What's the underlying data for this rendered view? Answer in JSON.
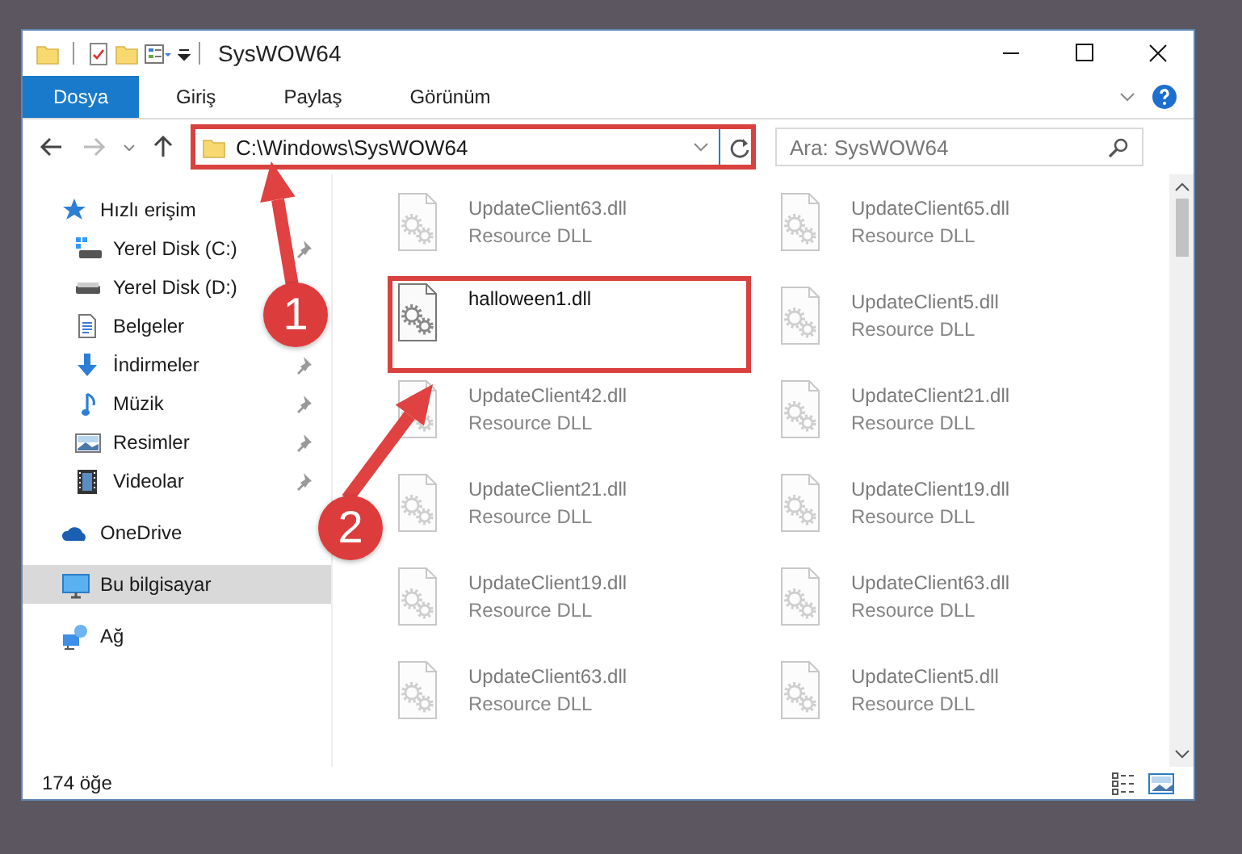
{
  "window": {
    "title": "SysWOW64"
  },
  "ribbon_tabs": [
    {
      "label": "Dosya",
      "selected": true
    },
    {
      "label": "Giriş",
      "selected": false
    },
    {
      "label": "Paylaş",
      "selected": false
    },
    {
      "label": "Görünüm",
      "selected": false
    }
  ],
  "address": {
    "path": "C:\\Windows\\SysWOW64",
    "highlighted": true
  },
  "search": {
    "placeholder": "Ara: SysWOW64"
  },
  "sidebar": {
    "items": [
      {
        "label": "Hızlı erişim",
        "selected": false,
        "children": [
          {
            "label": "Yerel Disk (C:)",
            "pinned": true,
            "selected": false
          },
          {
            "label": "Yerel Disk (D:)",
            "pinned": false,
            "selected": false
          },
          {
            "label": "Belgeler",
            "pinned": false,
            "selected": false
          },
          {
            "label": "İndirmeler",
            "pinned": true,
            "selected": false
          },
          {
            "label": "Müzik",
            "pinned": true,
            "selected": false
          },
          {
            "label": "Resimler",
            "pinned": true,
            "selected": false
          },
          {
            "label": "Videolar",
            "pinned": true,
            "selected": false
          }
        ]
      },
      {
        "label": "OneDrive",
        "selected": false
      },
      {
        "label": "Bu bilgisayar",
        "selected": true
      },
      {
        "label": "Ağ",
        "selected": false
      }
    ]
  },
  "files": [
    {
      "name": "UpdateClient63.dll",
      "type": "Resource DLL",
      "blurred": true,
      "highlighted": false
    },
    {
      "name": "UpdateClient65.dll",
      "type": "Resource DLL",
      "blurred": true,
      "highlighted": false
    },
    {
      "name": "halloween1.dll",
      "blurred": false,
      "highlighted": true
    },
    {
      "name": "UpdateClient5.dll",
      "type": "Resource DLL",
      "blurred": true,
      "highlighted": false
    },
    {
      "name": "UpdateClient42.dll",
      "type": "Resource DLL",
      "blurred": true,
      "highlighted": false
    },
    {
      "name": "UpdateClient21.dll",
      "type": "Resource DLL",
      "blurred": true,
      "highlighted": false
    },
    {
      "name": "UpdateClient21.dll",
      "type": "Resource DLL",
      "blurred": true,
      "highlighted": false
    },
    {
      "name": "UpdateClient19.dll",
      "type": "Resource DLL",
      "blurred": true,
      "highlighted": false
    },
    {
      "name": "UpdateClient19.dll",
      "type": "Resource DLL",
      "blurred": true,
      "highlighted": false
    },
    {
      "name": "UpdateClient63.dll",
      "type": "Resource DLL",
      "blurred": true,
      "highlighted": false
    },
    {
      "name": "UpdateClient63.dll",
      "type": "Resource DLL",
      "blurred": true,
      "highlighted": false
    },
    {
      "name": "UpdateClient5.dll",
      "type": "Resource DLL",
      "blurred": true,
      "highlighted": false
    }
  ],
  "status_bar": {
    "item_count": "174 öğe"
  },
  "annotations": [
    {
      "number": "1"
    },
    {
      "number": "2"
    }
  ]
}
